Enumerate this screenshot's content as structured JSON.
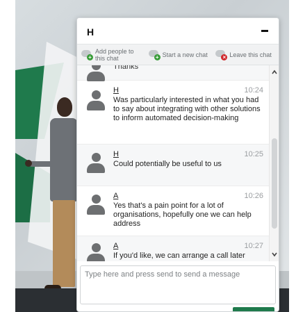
{
  "chat": {
    "title": "H",
    "toolbar": {
      "add_people": "Add people to this chat",
      "start_chat": "Start a new chat",
      "leave_chat": "Leave this chat"
    },
    "messages": [
      {
        "name": "",
        "time": "",
        "text": "Thanks"
      },
      {
        "name": "H",
        "time": "10:24",
        "text": "Was particularly interested in what you had to say about integrating with other solutions to inform automated decision-making"
      },
      {
        "name": "H",
        "time": "10:25",
        "text": "Could potentially be useful to us"
      },
      {
        "name": "A",
        "time": "10:26",
        "text": "Yes that's a pain point for a lot of organisations, hopefully one we can help address"
      },
      {
        "name": "A",
        "time": "10:27",
        "text": "If you'd like, we can arrange a call later"
      }
    ],
    "composer": {
      "placeholder": "Type here and press send to send a message"
    },
    "icons": {
      "add_people": "add-person-icon",
      "start_chat": "new-chat-icon",
      "leave_chat": "leave-chat-icon",
      "minimize": "minimize-icon"
    },
    "colors": {
      "accent_green": "#1f7a4c",
      "add_green": "#3a9d3a",
      "leave_red": "#d0262b"
    }
  }
}
